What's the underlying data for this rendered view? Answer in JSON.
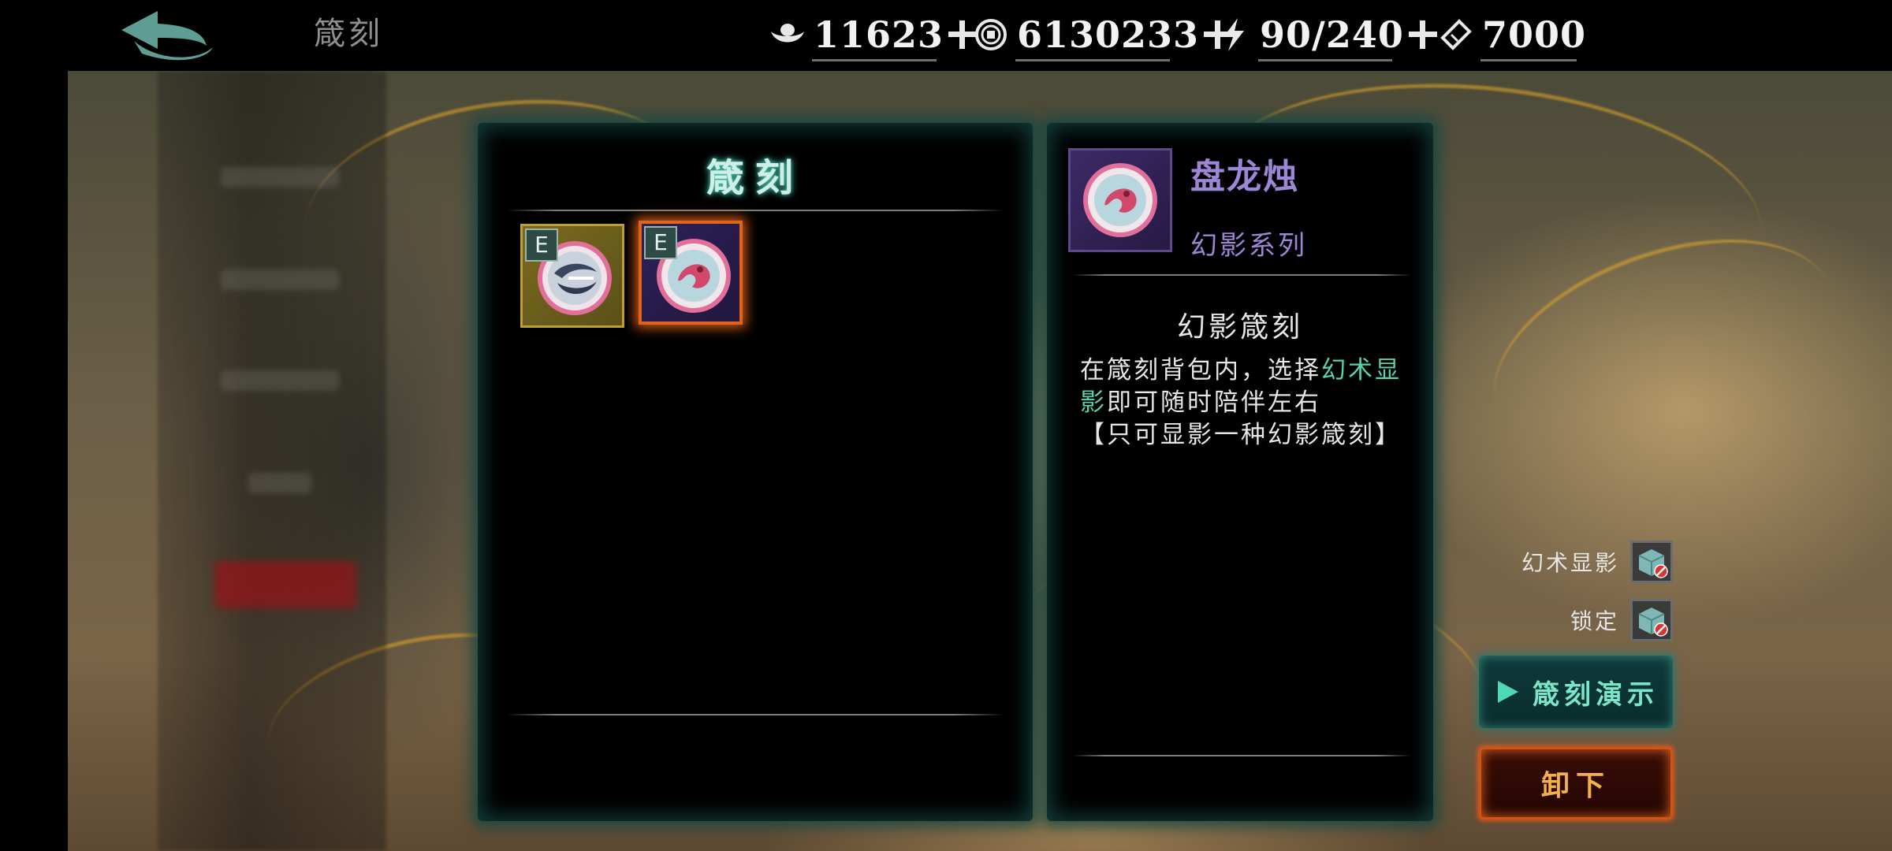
{
  "header": {
    "title": "箴刻",
    "currencies": [
      {
        "icon": "silver-ingot-icon",
        "value": "11623"
      },
      {
        "icon": "copper-coin-icon",
        "value": "6130233"
      },
      {
        "icon": "lightning-stamina-icon",
        "value": "90/240"
      },
      {
        "icon": "ticket-icon",
        "value": "7000"
      }
    ]
  },
  "grid": {
    "title": "箴刻",
    "slots": [
      {
        "badge": "E",
        "frame": "gold",
        "icon": "swirl-medallion-icon"
      },
      {
        "badge": "E",
        "frame": "purple",
        "icon": "dragon-medallion-icon",
        "selected": true
      }
    ]
  },
  "detail": {
    "name": "盘龙烛",
    "series": "幻影系列",
    "desc_title": "幻影箴刻",
    "desc_part1": "在箴刻背包内，选择",
    "desc_highlight": "幻术显影",
    "desc_part2": "即可随时陪伴左右",
    "desc_note": "【只可显影一种幻影箴刻】"
  },
  "controls": {
    "illusion_label": "幻术显影",
    "lock_label": "锁定",
    "demo_button": "箴刻演示",
    "unequip_button": "卸下"
  },
  "colors": {
    "accent_teal": "#56d3b0",
    "name_purple": "#9c86d6",
    "unequip_orange": "#f3b14a"
  }
}
